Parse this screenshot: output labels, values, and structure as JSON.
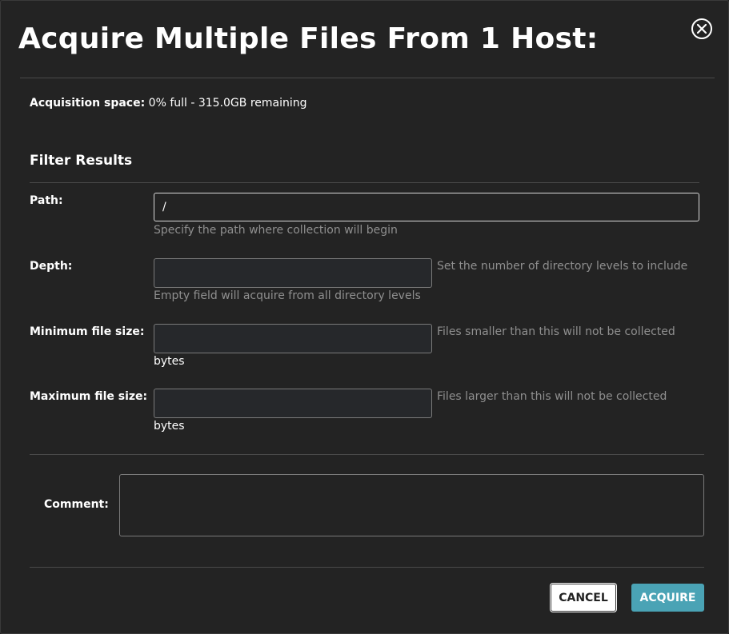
{
  "dialog": {
    "title": "Acquire Multiple Files From 1 Host:",
    "acquisition_space_label": "Acquisition space:",
    "acquisition_space_value": "0% full - 315.0GB remaining"
  },
  "filter": {
    "section_title": "Filter Results",
    "path": {
      "label": "Path:",
      "value": "/",
      "help": "Specify the path where collection will begin"
    },
    "depth": {
      "label": "Depth:",
      "value": "",
      "help_inline": "Set the number of directory levels to include",
      "help_below": "Empty field will acquire from all directory levels"
    },
    "min_size": {
      "label": "Minimum file size:",
      "value": "",
      "help_inline": "Files smaller than this will not be collected",
      "unit": "bytes"
    },
    "max_size": {
      "label": "Maximum file size:",
      "value": "",
      "help_inline": "Files larger than this will not be collected",
      "unit": "bytes"
    }
  },
  "comment": {
    "label": "Comment:",
    "value": ""
  },
  "buttons": {
    "cancel": "CANCEL",
    "acquire": "ACQUIRE"
  },
  "icons": {
    "close": "close-circle-icon"
  },
  "colors": {
    "background": "#232323",
    "accent": "#4aa3b5",
    "help_text": "#8f8f8f"
  }
}
